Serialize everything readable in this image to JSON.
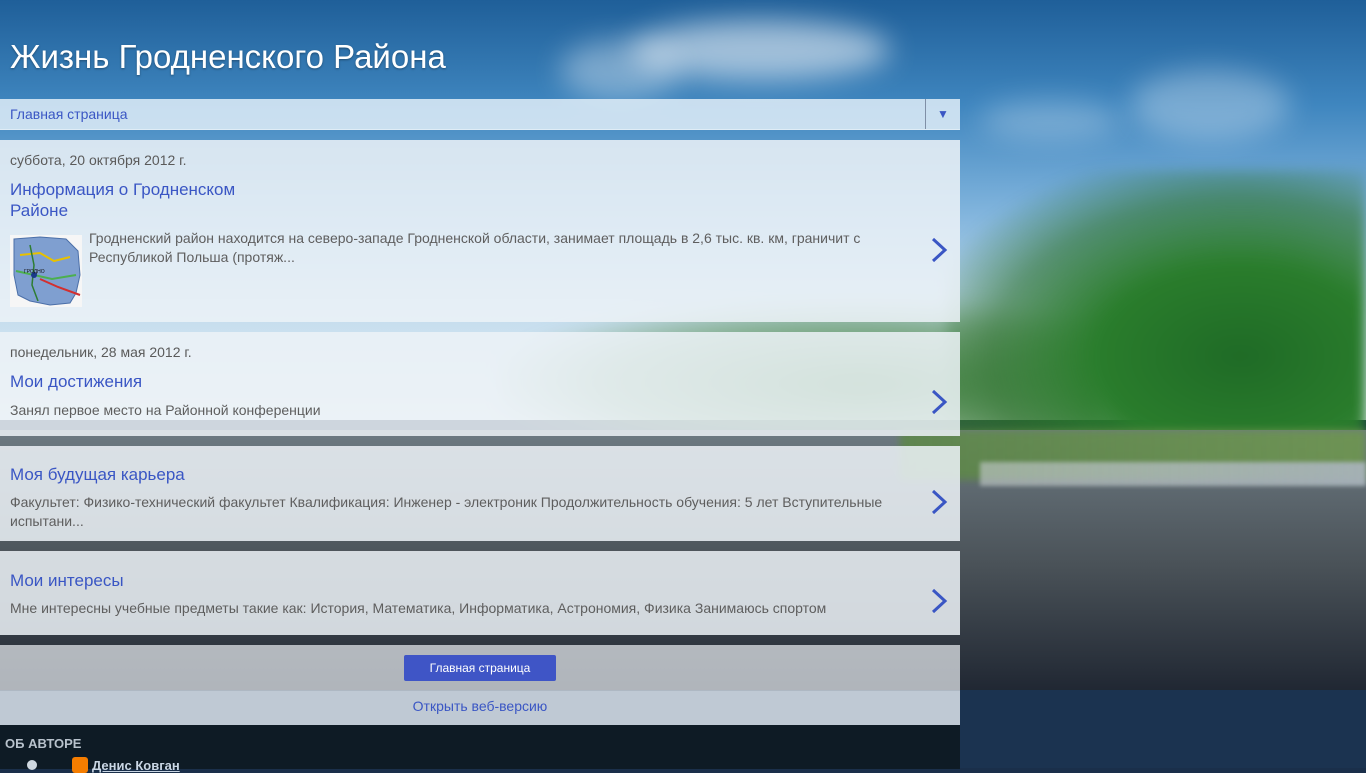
{
  "blog": {
    "title": "Жизнь Гродненского Района"
  },
  "nav": {
    "selected": "Главная страница"
  },
  "posts": [
    {
      "date": "суббота, 20 октября 2012 г.",
      "title_line1": "Информация о Гродненском",
      "title_line2": "Районе",
      "snippet_line1": "Гродненский район находится на северо-западе Гродненской области, занимает площадь в 2,6 тыс. кв. км, граничит с",
      "snippet_line2": "Республикой Польша (протяж..."
    },
    {
      "date": "понедельник, 28 мая 2012 г.",
      "title": "Мои достижения",
      "snippet": "Занял первое место на Районной конференции"
    },
    {
      "title": "Моя будущая карьера",
      "snippet_line1": "Факультет: Физико-технический факультет Квалификация: Инженер - электроник Продолжительность обучения: 5 лет Вступительные",
      "snippet_line2": "испытани..."
    },
    {
      "title": "Мои интересы",
      "snippet": "Мне интересны учебные предметы такие как: История, Математика, Информатика, Астрономия, Физика Занимаюсь спортом"
    }
  ],
  "footer": {
    "home_button": "Главная страница",
    "web_version": "Открыть веб-версию"
  },
  "about": {
    "header": "ОБ АВТОРЕ",
    "name": "Денис Ковган"
  },
  "colors": {
    "link": "#3a56c4",
    "button": "#3f55c6",
    "blogger_orange": "#f57d00"
  },
  "icons": {
    "dropdown": "triangle-down-icon",
    "post_arrow": "chevron-right-icon",
    "profile": "person-icon",
    "blogger": "blogger-icon"
  }
}
